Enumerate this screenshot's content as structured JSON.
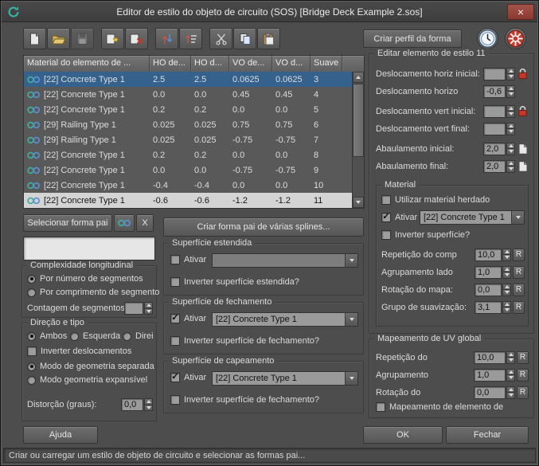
{
  "window": {
    "title": "Editor de estilo do objeto de circuito (SOS) [Bridge Deck Example 2.sos]",
    "close_glyph": "×",
    "status": "Criar ou carregar um estilo de objeto de circuito e selecionar as formas pai..."
  },
  "toolbar": {
    "create_profile": "Criar perfil da forma",
    "icons": [
      "new-style",
      "open-style",
      "save-style",
      "add-element",
      "remove-element",
      "reorder-elements",
      "sort-elements",
      "cut-element",
      "copy-element",
      "paste-element",
      "time-display",
      "system-settings"
    ]
  },
  "table": {
    "columns": [
      "Material do elemento de ...",
      "HO de...",
      "HO d...",
      "VO de...",
      "VO d...",
      "Suave"
    ],
    "rows": [
      {
        "material": "[22] Concrete Type 1",
        "ho_start": "2.5",
        "ho_end": "2.5",
        "vo_start": "0.0625",
        "vo_end": "0.0625",
        "smooth": "3",
        "state": "selected"
      },
      {
        "material": "[22] Concrete Type 1",
        "ho_start": "0.0",
        "ho_end": "0.0",
        "vo_start": "0.45",
        "vo_end": "0.45",
        "smooth": "4",
        "state": ""
      },
      {
        "material": "[22] Concrete Type 1",
        "ho_start": "0.2",
        "ho_end": "0.2",
        "vo_start": "0.0",
        "vo_end": "0.0",
        "smooth": "5",
        "state": ""
      },
      {
        "material": "[29] Railing Type 1",
        "ho_start": "0.025",
        "ho_end": "0.025",
        "vo_start": "0.75",
        "vo_end": "0.75",
        "smooth": "6",
        "state": ""
      },
      {
        "material": "[29] Railing Type 1",
        "ho_start": "0.025",
        "ho_end": "0.025",
        "vo_start": "-0.75",
        "vo_end": "-0.75",
        "smooth": "7",
        "state": ""
      },
      {
        "material": "[22] Concrete Type 1",
        "ho_start": "0.2",
        "ho_end": "0.2",
        "vo_start": "0.0",
        "vo_end": "0.0",
        "smooth": "8",
        "state": ""
      },
      {
        "material": "[22] Concrete Type 1",
        "ho_start": "0.0",
        "ho_end": "0.0",
        "vo_start": "-0.75",
        "vo_end": "-0.75",
        "smooth": "9",
        "state": ""
      },
      {
        "material": "[22] Concrete Type 1",
        "ho_start": "-0.4",
        "ho_end": "-0.4",
        "vo_start": "0.0",
        "vo_end": "0.0",
        "smooth": "10",
        "state": ""
      },
      {
        "material": "[22] Concrete Type 1",
        "ho_start": "-0.6",
        "ho_end": "-0.6",
        "vo_start": "-1.2",
        "vo_end": "-1.2",
        "smooth": "11",
        "state": "active"
      }
    ]
  },
  "left": {
    "select_parent_shape": "Selecionar forma pai",
    "clear_button": "X",
    "longitudinal": {
      "title": "Complexidade longitudinal",
      "radio_segments": "Por número de segmentos",
      "radio_length": "Por comprimento de segmento",
      "segment_count_label": "Contagem de segmentos:",
      "segment_count_value": ""
    },
    "direction": {
      "title": "Direção e tipo",
      "radio_both": "Ambos",
      "radio_left": "Esquerda",
      "radio_right": "Direi",
      "invert_offsets": "Inverter deslocamentos",
      "radio_separate": "Modo de geometria separada",
      "radio_expandable": "Modo geometria expansível",
      "twist_label": "Distorção (graus):",
      "twist_value": "0,0"
    }
  },
  "middle": {
    "create_parent_button": "Criar forma pai de várias splines...",
    "extended": {
      "title": "Superfície estendida",
      "enable": "Ativar",
      "combo": "",
      "invert": "Inverter superfície estendida?"
    },
    "closure": {
      "title": "Superfície de fechamento",
      "enable": "Ativar",
      "combo": "[22] Concrete Type 1",
      "invert": "Inverter superfície de fechamento?"
    },
    "capping": {
      "title": "Superfície de capeamento",
      "enable": "Ativar",
      "combo": "[22] Concrete Type 1",
      "invert": "Inverter superfície de fechamento?"
    }
  },
  "right": {
    "edit_group_title": "Editar elemento de estilo 11",
    "rows": [
      {
        "label": "Deslocamento horiz inicial:",
        "value": "",
        "icon": "lock"
      },
      {
        "label": "Deslocamento horizo",
        "value": "-0,6",
        "icon": ""
      },
      {
        "label": "Deslocamento vert inicial:",
        "value": "",
        "icon": "lock"
      },
      {
        "label": "Deslocamento vert final:",
        "value": "",
        "icon": ""
      },
      {
        "label": "Abaulamento inicial:",
        "value": "2,0",
        "icon": "page"
      },
      {
        "label": "Abaulamento final:",
        "value": "2,0",
        "icon": "page"
      }
    ],
    "material": {
      "title": "Material",
      "inherited": "Utilizar material herdado",
      "enable": "Ativar",
      "combo": "[22] Concrete Type 1",
      "invert": "Inverter superfície?",
      "rows": [
        {
          "label": "Repetição do comp",
          "value": "10,0",
          "r": "R"
        },
        {
          "label": "Agrupamento lado",
          "value": "1,0",
          "r": "R"
        },
        {
          "label": "Rotação do mapa:",
          "value": "0,0",
          "r": "R"
        },
        {
          "label": "Grupo de suavização:",
          "value": "3,1",
          "r": "R"
        }
      ]
    },
    "uv": {
      "title": "Mapeamento de UV global",
      "rows": [
        {
          "label": "Repetição do",
          "value": "10,0",
          "r": "R"
        },
        {
          "label": "Agrupamento",
          "value": "1,0",
          "r": "R"
        },
        {
          "label": "Rotação do",
          "value": "0,0",
          "r": "R"
        }
      ],
      "element_mapping": "Mapeamento de elemento de"
    }
  },
  "footer": {
    "help": "Ajuda",
    "ok": "OK",
    "close": "Fechar"
  },
  "colors": {
    "selection_blue": "#35618d",
    "active_row": "#d4d4d4",
    "lock_red": "#c2392b",
    "folder_yellow": "#d8b15a",
    "gear_red": "#c23b2e",
    "clock_face": "#e8f0f7"
  }
}
